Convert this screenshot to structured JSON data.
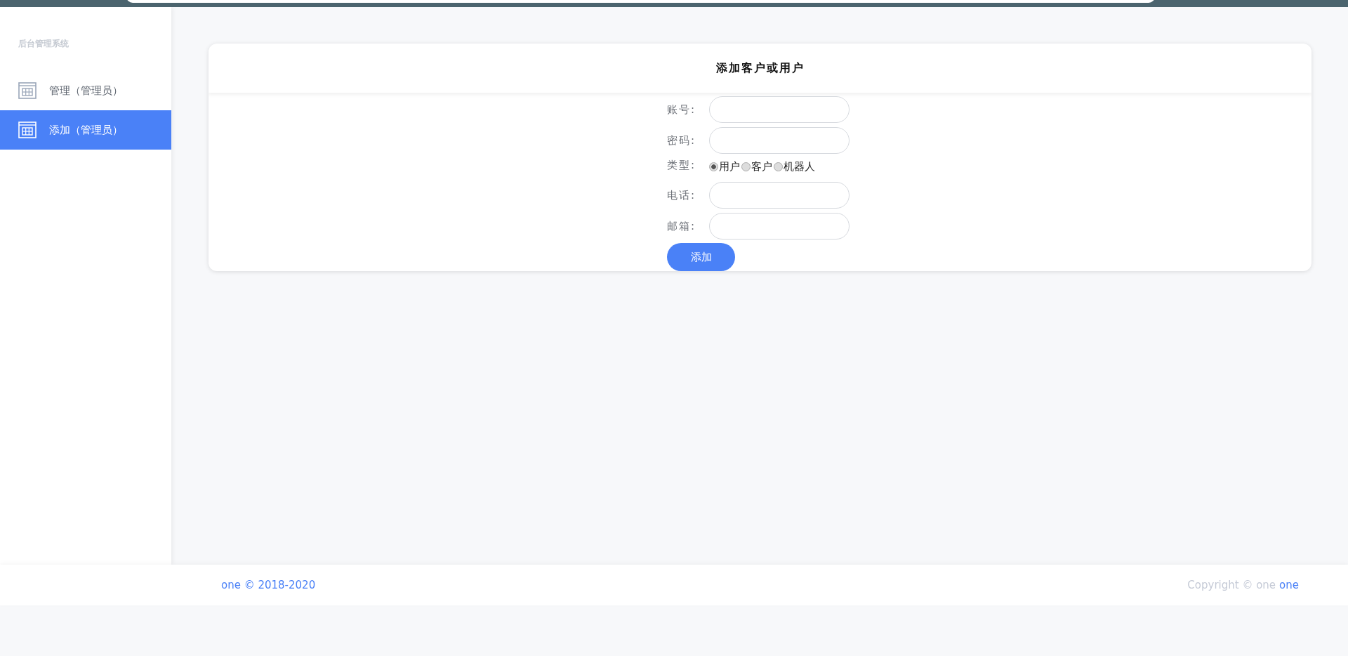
{
  "sidebar": {
    "title": "后台管理系统",
    "items": [
      {
        "label": "管理（管理员）",
        "selected": false
      },
      {
        "label": "添加（管理员）",
        "selected": true
      }
    ]
  },
  "card": {
    "title": "添加客户或用户",
    "fields": [
      {
        "kind": "text",
        "label": "账号:"
      },
      {
        "kind": "text",
        "label": "密码:"
      },
      {
        "kind": "radio",
        "label": "类型:",
        "options": [
          {
            "label": "用户",
            "selected": true
          },
          {
            "label": "客户",
            "selected": false
          },
          {
            "label": "机器人",
            "selected": false
          }
        ]
      },
      {
        "kind": "text",
        "label": "电话:"
      },
      {
        "kind": "text",
        "label": "邮箱:"
      }
    ],
    "submit": "添加"
  },
  "footer": {
    "left": "one © 2018-2020",
    "right": "Copyright © one",
    "right_link": "one"
  }
}
